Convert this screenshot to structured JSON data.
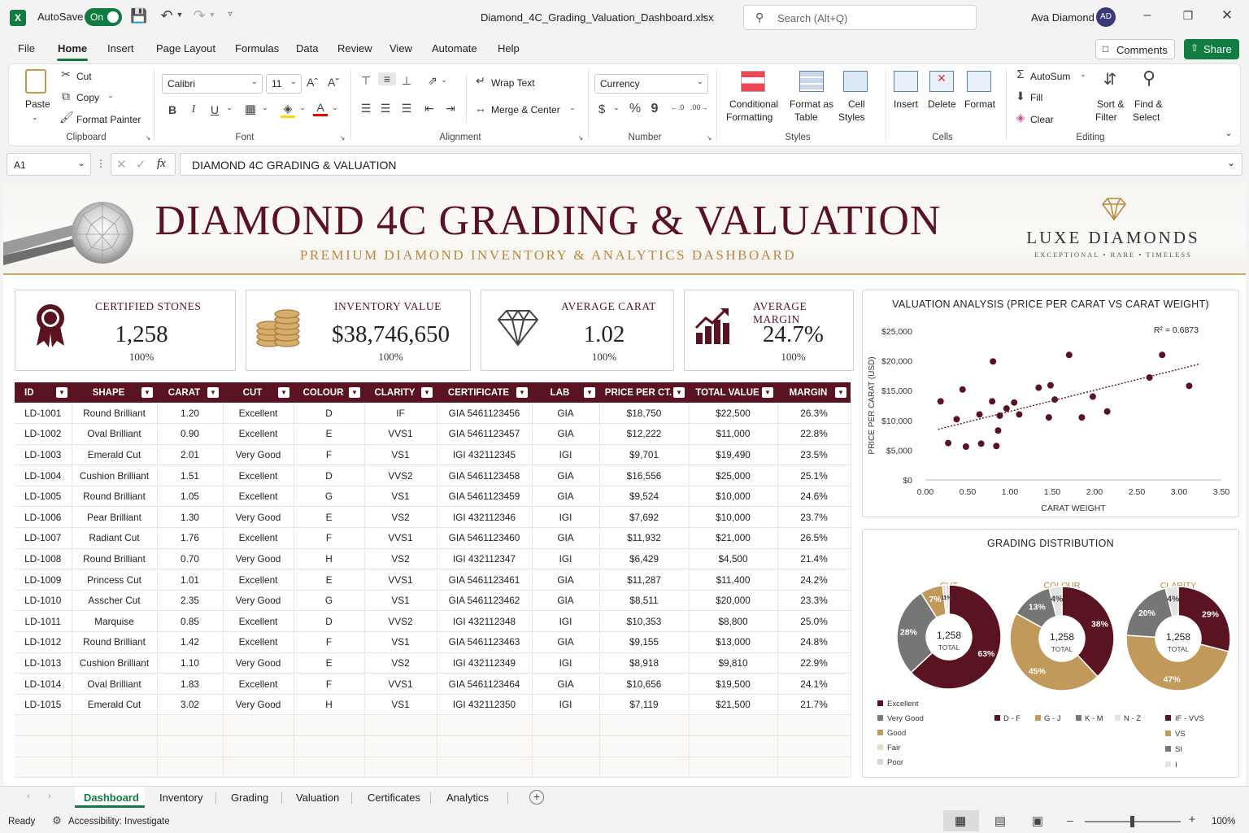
{
  "titlebar": {
    "autosave_label": "AutoSave",
    "autosave_state": "On",
    "filename": "Diamond_4C_Grading_Valuation_Dashboard.xlsx",
    "search_placeholder": "Search (Alt+Q)",
    "user_name": "Ava Diamond",
    "user_initials": "AD"
  },
  "menu": {
    "items": [
      "File",
      "Home",
      "Insert",
      "Page Layout",
      "Formulas",
      "Data",
      "Review",
      "View",
      "Automate",
      "Help"
    ],
    "active": "Home",
    "comments_label": "Comments",
    "share_label": "Share"
  },
  "ribbon": {
    "clipboard": {
      "paste": "Paste",
      "cut": "Cut",
      "copy": "Copy",
      "format_painter": "Format Painter",
      "group": "Clipboard"
    },
    "font": {
      "name": "Calibri",
      "size": "11",
      "bold": "B",
      "italic": "I",
      "underline": "U",
      "group": "Font"
    },
    "alignment": {
      "wrap": "Wrap Text",
      "merge": "Merge & Center",
      "group": "Alignment"
    },
    "number": {
      "format": "Currency",
      "dollar": "$",
      "percent": "%",
      "comma": "9",
      "group": "Number"
    },
    "styles": {
      "conditional_1": "Conditional",
      "conditional_2": "Formatting",
      "format_table_1": "Format as",
      "format_table_2": "Table",
      "cell_styles_1": "Cell",
      "cell_styles_2": "Styles",
      "group": "Styles"
    },
    "cells": {
      "insert": "Insert",
      "delete": "Delete",
      "format": "Format",
      "group": "Cells"
    },
    "editing": {
      "autosum": "AutoSum",
      "fill": "Fill",
      "clear": "Clear",
      "sort_1": "Sort &",
      "sort_2": "Filter",
      "find_1": "Find &",
      "find_2": "Select",
      "group": "Editing"
    }
  },
  "formula_bar": {
    "name_box": "A1",
    "fx": "fx",
    "content": "DIAMOND 4C GRADING & VALUATION"
  },
  "header": {
    "title": "DIAMOND 4C GRADING & VALUATION",
    "subtitle": "PREMIUM DIAMOND INVENTORY & ANALYTICS DASHBOARD",
    "brand": "LUXE DIAMONDS",
    "tagline": "EXCEPTIONAL • RARE • TIMELESS"
  },
  "kpis": [
    {
      "label": "CERTIFIED STONES",
      "value": "1,258",
      "pct": "100%",
      "icon": "award-ribbon-icon"
    },
    {
      "label": "INVENTORY VALUE",
      "value": "$38,746,650",
      "pct": "100%",
      "icon": "coins-icon"
    },
    {
      "label": "AVERAGE CARAT",
      "value": "1.02",
      "pct": "100%",
      "icon": "diamond-icon"
    },
    {
      "label": "AVERAGE MARGIN",
      "value": "24.7%",
      "pct": "100%",
      "icon": "bar-growth-icon"
    }
  ],
  "table": {
    "columns": [
      "ID",
      "SHAPE",
      "CARAT",
      "CUT",
      "COLOUR",
      "CLARITY",
      "CERTIFICATE",
      "LAB",
      "PRICE PER CT.",
      "TOTAL VALUE",
      "MARGIN"
    ],
    "rows": [
      [
        "LD-1001",
        "Round Brilliant",
        "1.20",
        "Excellent",
        "D",
        "IF",
        "GIA 5461123456",
        "GIA",
        "$18,750",
        "$22,500",
        "26.3%"
      ],
      [
        "LD-1002",
        "Oval Brilliant",
        "0.90",
        "Excellent",
        "E",
        "VVS1",
        "GIA 5461123457",
        "GIA",
        "$12,222",
        "$11,000",
        "22.8%"
      ],
      [
        "LD-1003",
        "Emerald Cut",
        "2.01",
        "Very Good",
        "F",
        "VS1",
        "IGI 432112345",
        "IGI",
        "$9,701",
        "$19,490",
        "23.5%"
      ],
      [
        "LD-1004",
        "Cushion Brilliant",
        "1.51",
        "Excellent",
        "D",
        "VVS2",
        "GIA 5461123458",
        "GIA",
        "$16,556",
        "$25,000",
        "25.1%"
      ],
      [
        "LD-1005",
        "Round Brilliant",
        "1.05",
        "Excellent",
        "G",
        "VS1",
        "GIA 5461123459",
        "GIA",
        "$9,524",
        "$10,000",
        "24.6%"
      ],
      [
        "LD-1006",
        "Pear Brilliant",
        "1.30",
        "Very Good",
        "E",
        "VS2",
        "IGI 432112346",
        "IGI",
        "$7,692",
        "$10,000",
        "23.7%"
      ],
      [
        "LD-1007",
        "Radiant Cut",
        "1.76",
        "Excellent",
        "F",
        "VVS1",
        "GIA 5461123460",
        "GIA",
        "$11,932",
        "$21,000",
        "26.5%"
      ],
      [
        "LD-1008",
        "Round Brilliant",
        "0.70",
        "Very Good",
        "H",
        "VS2",
        "IGI 432112347",
        "IGI",
        "$6,429",
        "$4,500",
        "21.4%"
      ],
      [
        "LD-1009",
        "Princess Cut",
        "1.01",
        "Excellent",
        "E",
        "VVS1",
        "GIA 5461123461",
        "GIA",
        "$11,287",
        "$11,400",
        "24.2%"
      ],
      [
        "LD-1010",
        "Asscher Cut",
        "2.35",
        "Very Good",
        "G",
        "VS1",
        "GIA 5461123462",
        "GIA",
        "$8,511",
        "$20,000",
        "23.3%"
      ],
      [
        "LD-1011",
        "Marquise",
        "0.85",
        "Excellent",
        "D",
        "VVS2",
        "IGI 432112348",
        "IGI",
        "$10,353",
        "$8,800",
        "25.0%"
      ],
      [
        "LD-1012",
        "Round Brilliant",
        "1.42",
        "Excellent",
        "F",
        "VS1",
        "GIA 5461123463",
        "GIA",
        "$9,155",
        "$13,000",
        "24.8%"
      ],
      [
        "LD-1013",
        "Cushion Brilliant",
        "1.10",
        "Very Good",
        "E",
        "VS2",
        "IGI 432112349",
        "IGI",
        "$8,918",
        "$9,810",
        "22.9%"
      ],
      [
        "LD-1014",
        "Oval Brilliant",
        "1.83",
        "Excellent",
        "F",
        "VVS1",
        "GIA 5461123464",
        "GIA",
        "$10,656",
        "$19,500",
        "24.1%"
      ],
      [
        "LD-1015",
        "Emerald Cut",
        "3.02",
        "Very Good",
        "H",
        "VS1",
        "IGI 432112350",
        "IGI",
        "$7,119",
        "$21,500",
        "21.7%"
      ]
    ]
  },
  "chart_data": [
    {
      "type": "scatter",
      "title": "VALUATION ANALYSIS (PRICE PER CARAT VS CARAT WEIGHT)",
      "xlabel": "CARAT WEIGHT",
      "ylabel": "PRICE PER CARAT (USD)",
      "xlim": [
        0,
        3.5
      ],
      "ylim": [
        0,
        25000
      ],
      "xticks": [
        "0.00",
        "0.50",
        "1.00",
        "1.50",
        "2.00",
        "2.50",
        "3.00",
        "3.50"
      ],
      "yticks": [
        "$0",
        "$5,000",
        "$10,000",
        "$15,000",
        "$20,000",
        "$25,000"
      ],
      "annotation": "R² = 0.6873",
      "trendline": [
        [
          0.15,
          8500
        ],
        [
          3.25,
          19500
        ]
      ],
      "points": [
        [
          0.18,
          13200
        ],
        [
          0.27,
          6200
        ],
        [
          0.37,
          10200
        ],
        [
          0.44,
          15200
        ],
        [
          0.48,
          5600
        ],
        [
          0.64,
          11000
        ],
        [
          0.66,
          6100
        ],
        [
          0.79,
          13200
        ],
        [
          0.8,
          19900
        ],
        [
          0.84,
          5700
        ],
        [
          0.86,
          8300
        ],
        [
          0.88,
          10800
        ],
        [
          0.96,
          12000
        ],
        [
          1.05,
          13000
        ],
        [
          1.11,
          11000
        ],
        [
          1.34,
          15500
        ],
        [
          1.46,
          10500
        ],
        [
          1.48,
          15900
        ],
        [
          1.53,
          13500
        ],
        [
          1.7,
          21000
        ],
        [
          1.85,
          10500
        ],
        [
          1.98,
          14000
        ],
        [
          2.15,
          11500
        ],
        [
          2.65,
          17200
        ],
        [
          2.8,
          21000
        ],
        [
          3.12,
          15800
        ]
      ],
      "color": "#5a1320"
    },
    {
      "type": "pie",
      "title": "GRADING DISTRIBUTION",
      "center_value": "1,258",
      "center_label": "TOTAL",
      "charts": [
        {
          "title": "CUT",
          "slices": [
            {
              "label": "Excellent",
              "value": 63,
              "text": "63%",
              "color": "#5a1320"
            },
            {
              "label": "Very Good",
              "value": 28,
              "text": "28%",
              "color": "#767676"
            },
            {
              "label": "Good",
              "value": 7,
              "text": "7%",
              "color": "#c19a5b"
            },
            {
              "label": "Fair",
              "value": 1,
              "text": "1%",
              "color": "#e6dbc8"
            },
            {
              "label": "Poor",
              "value": 1,
              "text": "1%",
              "color": "#d6d6d6"
            }
          ]
        },
        {
          "title": "COLOUR",
          "slices": [
            {
              "label": "D - F",
              "value": 38,
              "text": "38%",
              "color": "#5a1320"
            },
            {
              "label": "G - J",
              "value": 45,
              "text": "45%",
              "color": "#c19a5b"
            },
            {
              "label": "K - M",
              "value": 13,
              "text": "13%",
              "color": "#767676"
            },
            {
              "label": "N - Z",
              "value": 4,
              "text": "4%",
              "color": "#e3e3e3"
            }
          ]
        },
        {
          "title": "CLARITY",
          "slices": [
            {
              "label": "IF - VVS",
              "value": 29,
              "text": "29%",
              "color": "#5a1320"
            },
            {
              "label": "VS",
              "value": 47,
              "text": "47%",
              "color": "#c19a5b"
            },
            {
              "label": "SI",
              "value": 20,
              "text": "20%",
              "color": "#767676"
            },
            {
              "label": "I",
              "value": 4,
              "text": "4%",
              "color": "#e3e3e3"
            }
          ]
        }
      ]
    }
  ],
  "sheet_tabs": {
    "items": [
      "Dashboard",
      "Inventory",
      "Grading",
      "Valuation",
      "Certificates",
      "Analytics"
    ],
    "active": "Dashboard"
  },
  "status": {
    "ready": "Ready",
    "accessibility": "Accessibility: Investigate",
    "zoom": "100%"
  },
  "colors": {
    "accent": "#5a1320",
    "gold": "#c19a5b",
    "excel_green": "#107c41"
  }
}
